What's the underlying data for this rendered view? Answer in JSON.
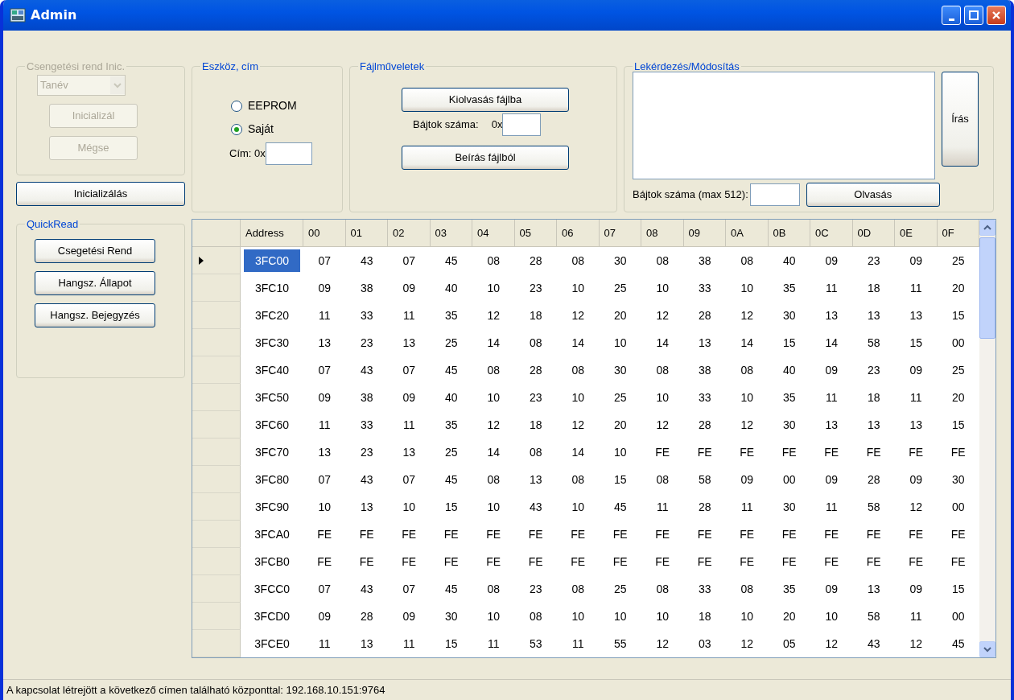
{
  "window": {
    "title": "Admin"
  },
  "bell_init": {
    "title": "Csengetési rend Inic.",
    "disabled": true,
    "dropdown": {
      "value": "Tanév"
    },
    "buttons": [
      "Inicializál",
      "Mégse"
    ]
  },
  "init_button": "Inicializálás",
  "device": {
    "title": "Eszköz, cím",
    "options": [
      {
        "label": "EEPROM",
        "selected": false
      },
      {
        "label": "Saját",
        "selected": true
      }
    ],
    "address_label": "Cím: 0x"
  },
  "file_ops": {
    "title": "Fájlműveletek",
    "read_button": "Kiolvasás fájlba",
    "count_label": "Bájtok száma:",
    "prefix": "0x",
    "write_button": "Beírás fájlból"
  },
  "query": {
    "title": "Lekérdezés/Módosítás",
    "write_button": "Írás",
    "count_label": "Bájtok száma (max 512):",
    "read_button": "Olvasás"
  },
  "quickread": {
    "title": "QuickRead",
    "buttons": [
      "Csegetési Rend",
      "Hangsz. Állapot",
      "Hangsz. Bejegyzés"
    ]
  },
  "table": {
    "columns": [
      "Address",
      "00",
      "01",
      "02",
      "03",
      "04",
      "05",
      "06",
      "07",
      "08",
      "09",
      "0A",
      "0B",
      "0C",
      "0D",
      "0E",
      "0F"
    ],
    "rows": [
      {
        "address": "3FC00",
        "selected": true,
        "cells": [
          "07",
          "43",
          "07",
          "45",
          "08",
          "28",
          "08",
          "30",
          "08",
          "38",
          "08",
          "40",
          "09",
          "23",
          "09",
          "25"
        ]
      },
      {
        "address": "3FC10",
        "selected": false,
        "cells": [
          "09",
          "38",
          "09",
          "40",
          "10",
          "23",
          "10",
          "25",
          "10",
          "33",
          "10",
          "35",
          "11",
          "18",
          "11",
          "20"
        ]
      },
      {
        "address": "3FC20",
        "selected": false,
        "cells": [
          "11",
          "33",
          "11",
          "35",
          "12",
          "18",
          "12",
          "20",
          "12",
          "28",
          "12",
          "30",
          "13",
          "13",
          "13",
          "15"
        ]
      },
      {
        "address": "3FC30",
        "selected": false,
        "cells": [
          "13",
          "23",
          "13",
          "25",
          "14",
          "08",
          "14",
          "10",
          "14",
          "13",
          "14",
          "15",
          "14",
          "58",
          "15",
          "00"
        ]
      },
      {
        "address": "3FC40",
        "selected": false,
        "cells": [
          "07",
          "43",
          "07",
          "45",
          "08",
          "28",
          "08",
          "30",
          "08",
          "38",
          "08",
          "40",
          "09",
          "23",
          "09",
          "25"
        ]
      },
      {
        "address": "3FC50",
        "selected": false,
        "cells": [
          "09",
          "38",
          "09",
          "40",
          "10",
          "23",
          "10",
          "25",
          "10",
          "33",
          "10",
          "35",
          "11",
          "18",
          "11",
          "20"
        ]
      },
      {
        "address": "3FC60",
        "selected": false,
        "cells": [
          "11",
          "33",
          "11",
          "35",
          "12",
          "18",
          "12",
          "20",
          "12",
          "28",
          "12",
          "30",
          "13",
          "13",
          "13",
          "15"
        ]
      },
      {
        "address": "3FC70",
        "selected": false,
        "cells": [
          "13",
          "23",
          "13",
          "25",
          "14",
          "08",
          "14",
          "10",
          "FE",
          "FE",
          "FE",
          "FE",
          "FE",
          "FE",
          "FE",
          "FE"
        ]
      },
      {
        "address": "3FC80",
        "selected": false,
        "cells": [
          "07",
          "43",
          "07",
          "45",
          "08",
          "13",
          "08",
          "15",
          "08",
          "58",
          "09",
          "00",
          "09",
          "28",
          "09",
          "30"
        ]
      },
      {
        "address": "3FC90",
        "selected": false,
        "cells": [
          "10",
          "13",
          "10",
          "15",
          "10",
          "43",
          "10",
          "45",
          "11",
          "28",
          "11",
          "30",
          "11",
          "58",
          "12",
          "00"
        ]
      },
      {
        "address": "3FCA0",
        "selected": false,
        "cells": [
          "FE",
          "FE",
          "FE",
          "FE",
          "FE",
          "FE",
          "FE",
          "FE",
          "FE",
          "FE",
          "FE",
          "FE",
          "FE",
          "FE",
          "FE",
          "FE"
        ]
      },
      {
        "address": "3FCB0",
        "selected": false,
        "cells": [
          "FE",
          "FE",
          "FE",
          "FE",
          "FE",
          "FE",
          "FE",
          "FE",
          "FE",
          "FE",
          "FE",
          "FE",
          "FE",
          "FE",
          "FE",
          "FE"
        ]
      },
      {
        "address": "3FCC0",
        "selected": false,
        "cells": [
          "07",
          "43",
          "07",
          "45",
          "08",
          "23",
          "08",
          "25",
          "08",
          "33",
          "08",
          "35",
          "09",
          "13",
          "09",
          "15"
        ]
      },
      {
        "address": "3FCD0",
        "selected": false,
        "cells": [
          "09",
          "28",
          "09",
          "30",
          "10",
          "08",
          "10",
          "10",
          "10",
          "18",
          "10",
          "20",
          "10",
          "58",
          "11",
          "00"
        ]
      },
      {
        "address": "3FCE0",
        "selected": false,
        "cells": [
          "11",
          "13",
          "11",
          "15",
          "11",
          "53",
          "11",
          "55",
          "12",
          "03",
          "12",
          "05",
          "12",
          "43",
          "12",
          "45"
        ]
      }
    ]
  },
  "status_bar": "A kapcsolat létrejött a következő címen található központtal: 192.168.10.151:9764"
}
